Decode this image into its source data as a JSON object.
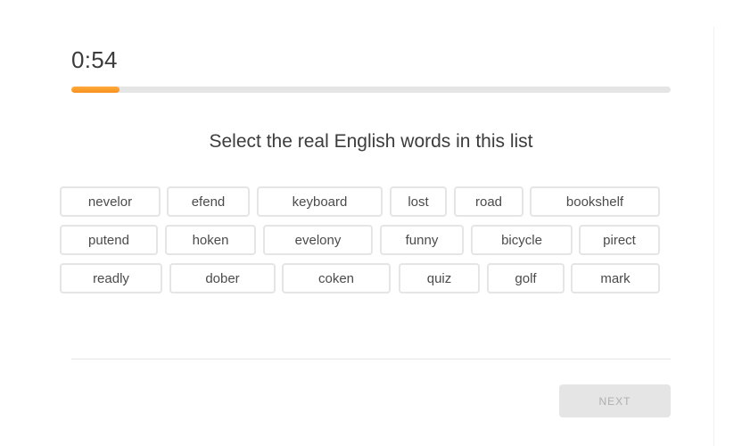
{
  "timer": "0:54",
  "progress_fraction": 0.08,
  "colors": {
    "progress_fill": "#f7901e",
    "progress_track": "#e5e5e5",
    "button_border": "#e5e5e5",
    "next_disabled_bg": "#e5e5e5",
    "next_disabled_text": "#afafaf"
  },
  "prompt": "Select the real English words in this list",
  "words": [
    [
      "nevelor",
      "efend",
      "keyboard",
      "lost",
      "road",
      "bookshelf"
    ],
    [
      "putend",
      "hoken",
      "evelony",
      "funny",
      "bicycle",
      "pirect"
    ],
    [
      "readly",
      "dober",
      "coken",
      "quiz",
      "golf",
      "mark"
    ]
  ],
  "next_label": "NEXT"
}
